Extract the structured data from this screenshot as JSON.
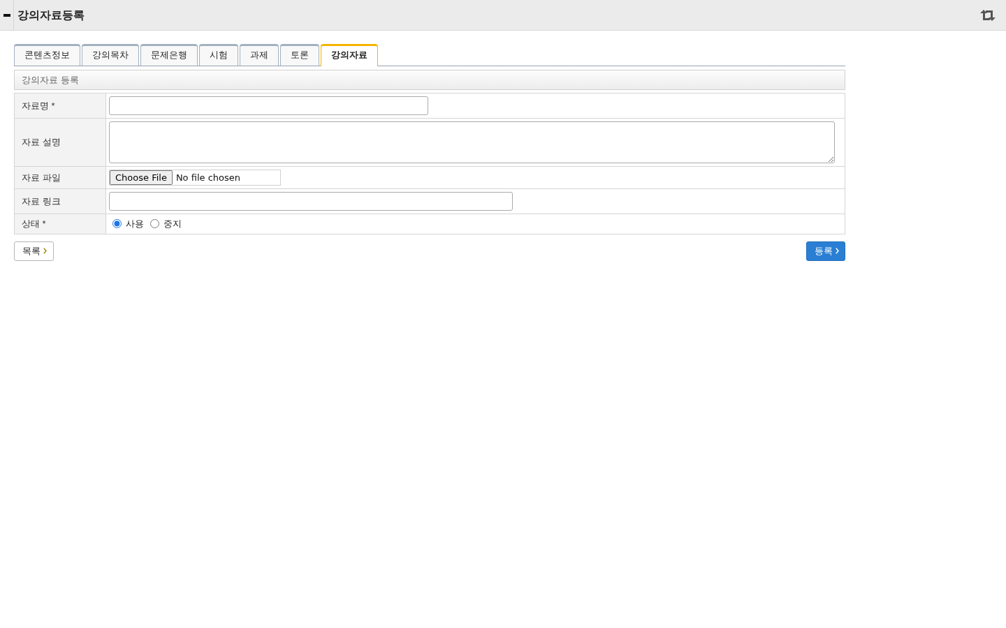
{
  "header": {
    "title": "강의자료등록"
  },
  "tabs": [
    {
      "label": "콘텐츠정보",
      "selected": false
    },
    {
      "label": "강의목차",
      "selected": false
    },
    {
      "label": "문제은행",
      "selected": false
    },
    {
      "label": "시험",
      "selected": false
    },
    {
      "label": "과제",
      "selected": false
    },
    {
      "label": "토론",
      "selected": false
    },
    {
      "label": "강의자료",
      "selected": true
    }
  ],
  "section": {
    "title": "강의자료 등록"
  },
  "form": {
    "rows": [
      {
        "kind": "text",
        "label": "자료명 *"
      },
      {
        "kind": "textarea",
        "label": "자료 설명"
      },
      {
        "kind": "file",
        "label": "자료 파일",
        "button": "Choose File",
        "status": "No file chosen"
      },
      {
        "kind": "url",
        "label": "자료 링크"
      },
      {
        "kind": "radio",
        "label": "상태 *",
        "options": [
          {
            "label": "사용",
            "selected": true
          },
          {
            "label": "중지",
            "selected": false
          }
        ]
      }
    ]
  },
  "buttons": {
    "list": {
      "label": "목록"
    },
    "submit": {
      "label": "등록"
    }
  }
}
